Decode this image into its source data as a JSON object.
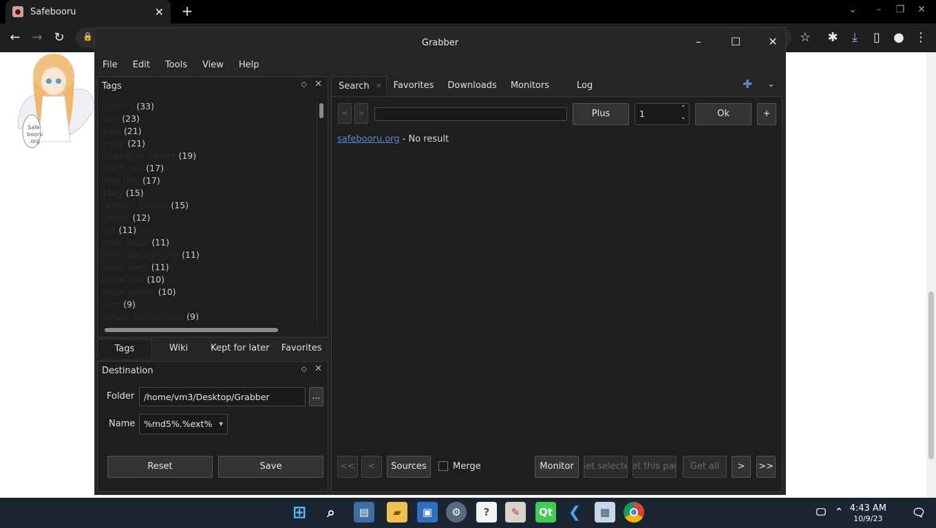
{
  "browser": {
    "tab_title": "Safebooru",
    "tab_close": "✕",
    "new_tab": "+"
  },
  "grabber": {
    "title": "Grabber",
    "menu": [
      "File",
      "Edit",
      "Tools",
      "View",
      "Help"
    ],
    "tags_panel": {
      "title": "Tags",
      "items": [
        {
          "name": "highres",
          "count": "(33)"
        },
        {
          "name": "solo",
          "count": "(23)"
        },
        {
          "name": "1girl",
          "count": "(21)"
        },
        {
          "name": "smile",
          "count": "(21)"
        },
        {
          "name": "looking at viewer",
          "count": "(19)"
        },
        {
          "name": "short hair",
          "count": "(17)"
        },
        {
          "name": "long hair",
          "count": "(17)"
        },
        {
          "name": "1boy",
          "count": "(15)"
        },
        {
          "name": "genshin impact",
          "count": "(15)"
        },
        {
          "name": "gloves",
          "count": "(12)"
        },
        {
          "name": "hat",
          "count": "(11)"
        },
        {
          "name": "male focus",
          "count": "(11)"
        },
        {
          "name": "white background",
          "count": "(11)"
        },
        {
          "name": "violet eyes",
          "count": "(11)"
        },
        {
          "name": "black hair",
          "count": "(10)"
        },
        {
          "name": "black gloves",
          "count": "(10)"
        },
        {
          "name": "skirt",
          "count": "(9)"
        },
        {
          "name": "simple background",
          "count": "(9)"
        }
      ]
    },
    "bottom_tabs": [
      "Tags",
      "Wiki",
      "Kept for later",
      "Favorites"
    ],
    "destination": {
      "title": "Destination",
      "folder_label": "Folder",
      "folder_value": "/home/vm3/Desktop/Grabber",
      "browse_label": "...",
      "name_label": "Name",
      "name_value": "%md5%.%ext%",
      "reset_label": "Reset",
      "save_label": "Save"
    },
    "main_tabs": [
      "Search",
      "Favorites",
      "Downloads",
      "Monitors",
      "Log"
    ],
    "search": {
      "prev": "<",
      "next": ">",
      "query": "",
      "plus_label": "Plus",
      "page": "1",
      "ok_label": "Ok",
      "add_label": "+",
      "result_site": "safebooru.org",
      "result_text": " - No result"
    },
    "footer": {
      "first": "<<",
      "prev": "<",
      "sources": "Sources",
      "merge": "Merge",
      "monitor": "Monitor",
      "get_selected": "Get selected",
      "get_this_page": "Get this page",
      "get_all": "Get all",
      "next": ">",
      "last": ">>"
    }
  },
  "taskbar": {
    "time": "4:43 AM",
    "date": "10/9/23"
  }
}
